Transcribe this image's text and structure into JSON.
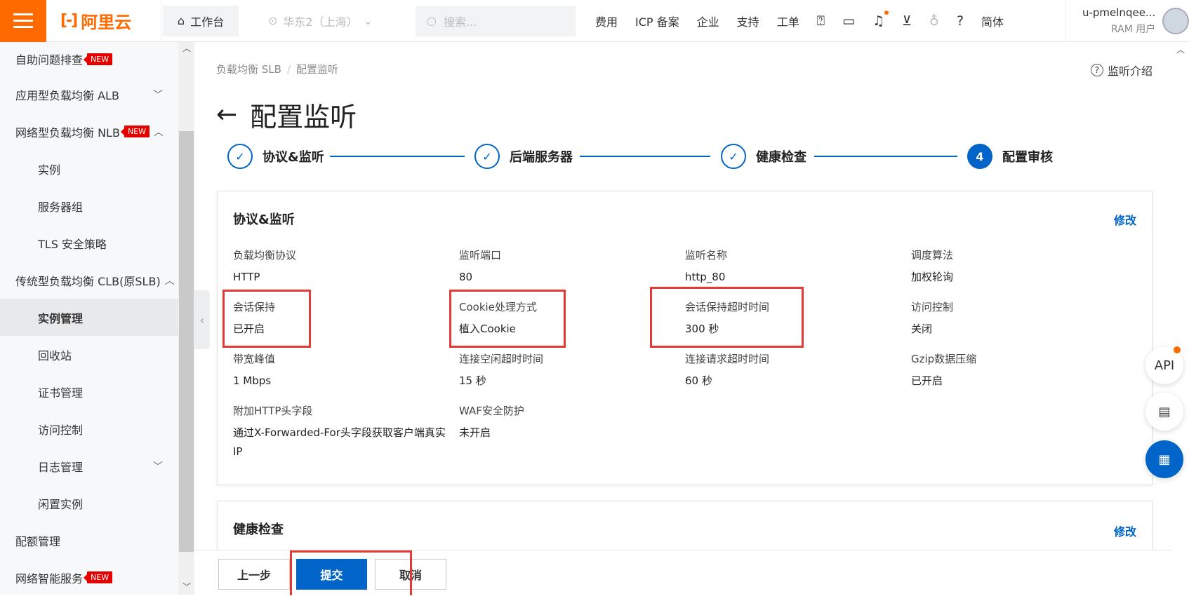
{
  "topbar": {
    "logo_text": "阿里云",
    "workbench": "工作台",
    "region": "华东2（上海）",
    "search_placeholder": "搜索...",
    "nav": [
      "费用",
      "ICP 备案",
      "企业",
      "支持",
      "工单"
    ],
    "lang": "简体",
    "user_name": "u-pmelnqee...",
    "user_role": "RAM 用户"
  },
  "sidebar": {
    "items": [
      {
        "label": "自助问题排查",
        "badge": "NEW"
      },
      {
        "label": "应用型负载均衡 ALB"
      },
      {
        "label": "网络型负载均衡 NLB",
        "badge": "NEW"
      },
      {
        "label": "实例"
      },
      {
        "label": "服务器组"
      },
      {
        "label": "TLS 安全策略"
      },
      {
        "label": "传统型负载均衡 CLB(原SLB)"
      },
      {
        "label": "实例管理"
      },
      {
        "label": "回收站"
      },
      {
        "label": "证书管理"
      },
      {
        "label": "访问控制"
      },
      {
        "label": "日志管理"
      },
      {
        "label": "闲置实例"
      },
      {
        "label": "配额管理"
      },
      {
        "label": "网络智能服务",
        "badge": "NEW"
      }
    ]
  },
  "breadcrumb": [
    "负载均衡 SLB",
    "配置监听"
  ],
  "help_link": "监听介绍",
  "page_title": "配置监听",
  "steps": [
    {
      "label": "协议&监听",
      "status": "done"
    },
    {
      "label": "后端服务器",
      "status": "done"
    },
    {
      "label": "健康检查",
      "status": "done"
    },
    {
      "label": "配置审核",
      "status": "current",
      "number": "4"
    }
  ],
  "card1": {
    "title": "协议&监听",
    "edit": "修改",
    "fields": [
      {
        "label": "负载均衡协议",
        "value": "HTTP"
      },
      {
        "label": "监听端口",
        "value": "80"
      },
      {
        "label": "监听名称",
        "value": "http_80"
      },
      {
        "label": "调度算法",
        "value": "加权轮询"
      },
      {
        "label": "会话保持",
        "value": "已开启"
      },
      {
        "label": "Cookie处理方式",
        "value": "植入Cookie"
      },
      {
        "label": "会话保持超时时间",
        "value": "300 秒"
      },
      {
        "label": "访问控制",
        "value": "关闭"
      },
      {
        "label": "带宽峰值",
        "value": "1 Mbps"
      },
      {
        "label": "连接空闲超时时间",
        "value": "15 秒"
      },
      {
        "label": "连接请求超时时间",
        "value": "60 秒"
      },
      {
        "label": "Gzip数据压缩",
        "value": "已开启"
      },
      {
        "label": "附加HTTP头字段",
        "value": "通过X-Forwarded-For头字段获取客户端真实IP"
      },
      {
        "label": "WAF安全防护",
        "value": "未开启"
      }
    ]
  },
  "card2": {
    "title": "健康检查",
    "edit": "修改"
  },
  "footer": {
    "prev": "上一步",
    "submit": "提交",
    "cancel": "取消"
  },
  "floats": {
    "api": "API"
  },
  "colors": {
    "brand": "#ff6a00",
    "primary": "#0064c8",
    "highlight": "#e53935"
  }
}
